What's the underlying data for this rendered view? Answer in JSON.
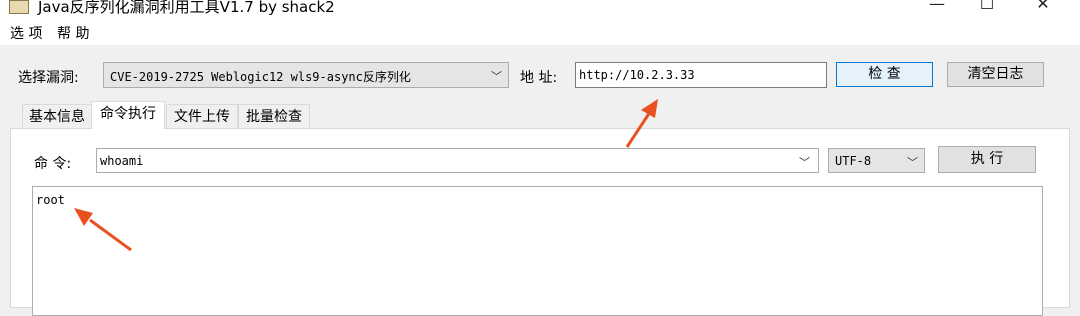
{
  "window": {
    "title": "Java反序列化漏洞利用工具V1.7 by shack2",
    "minimize_glyph": "—",
    "maximize_glyph": "☐",
    "close_glyph": "✕"
  },
  "menu": {
    "items": [
      "选 项",
      "帮 助"
    ]
  },
  "toolbar": {
    "vuln_label": "选择漏洞:",
    "vuln_selected": "CVE-2019-2725 Weblogic12 wls9-async反序列化",
    "address_label": "地 址:",
    "address_value": "http://10.2.3.33",
    "check_button": "检 查",
    "clear_log_button": "清空日志"
  },
  "tabs": [
    {
      "label": "基本信息",
      "active": false
    },
    {
      "label": "命令执行",
      "active": true
    },
    {
      "label": "文件上传",
      "active": false
    },
    {
      "label": "批量检查",
      "active": false
    }
  ],
  "command": {
    "label": "命 令:",
    "value": "whoami",
    "encoding": "UTF-8",
    "execute_button": "执 行"
  },
  "output": {
    "text": "root"
  },
  "annotations": {
    "arrow_color": "#e8501f"
  }
}
